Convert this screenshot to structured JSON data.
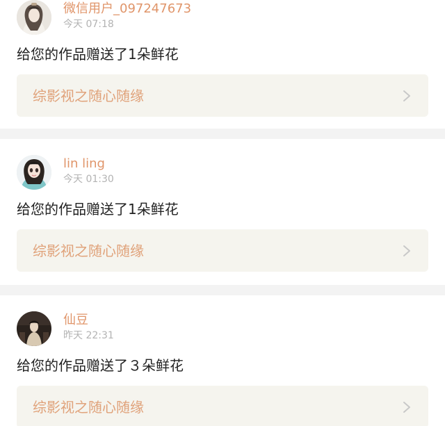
{
  "notifications": [
    {
      "username": "微信用户_097247673",
      "time": "今天 07:18",
      "message": "给您的作品赠送了1朵鲜花",
      "work_title": "综影视之随心随缘",
      "avatar_icon": "avatar-ancient-costume-figure-icon"
    },
    {
      "username": "lin ling",
      "time": "今天 01:30",
      "message": "给您的作品赠送了1朵鲜花",
      "work_title": "综影视之随心随缘",
      "avatar_icon": "avatar-doll-girl-icon"
    },
    {
      "username": "仙豆",
      "time": "昨天 22:31",
      "message": "给您的作品赠送了３朵鲜花",
      "work_title": "综影视之随心随缘",
      "avatar_icon": "avatar-ancient-figure-dark-icon"
    }
  ],
  "colors": {
    "username": "#e0956a",
    "time": "#b3b3b3",
    "message": "#222222",
    "work_title": "#e0a27a",
    "work_link_bg": "#f5f4ee",
    "divider": "#f3f3f3",
    "chevron": "#c8c8c8"
  }
}
